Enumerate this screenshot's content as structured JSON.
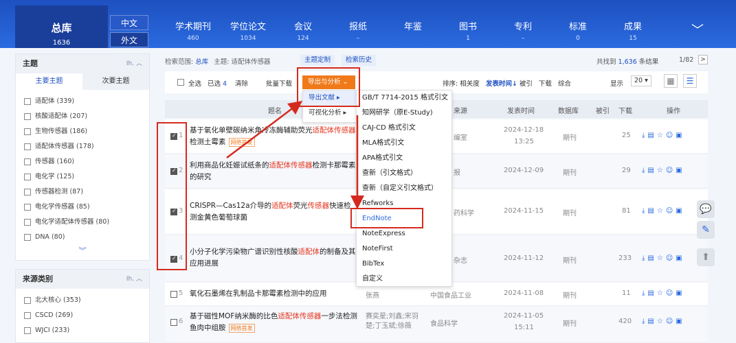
{
  "topnav": {
    "main": {
      "label": "总库",
      "count": "1636"
    },
    "lang": [
      "中文",
      "外文"
    ],
    "items": [
      {
        "label": "学术期刊",
        "count": "460"
      },
      {
        "label": "学位论文",
        "count": "1034"
      },
      {
        "label": "会议",
        "count": "124"
      },
      {
        "label": "报纸",
        "count": ""
      },
      {
        "label": "年鉴",
        "count": ""
      },
      {
        "label": "图书",
        "count": "1"
      },
      {
        "label": "专利",
        "count": ""
      },
      {
        "label": "标准",
        "count": "0"
      },
      {
        "label": "成果",
        "count": "15"
      }
    ]
  },
  "left": {
    "topic_title": "主题",
    "tabs": [
      "主要主题",
      "次要主题"
    ],
    "topics": [
      "适配体 (339)",
      "核酸适配体 (207)",
      "生物传感器 (186)",
      "适配体传感器 (178)",
      "传感器 (160)",
      "电化学 (125)",
      "传感器检测 (87)",
      "电化学传感器 (85)",
      "电化学适配体传感器 (80)",
      "DNA (80)"
    ],
    "source_title": "来源类别",
    "sources": [
      "北大核心 (353)",
      "CSCD (269)",
      "WJCI (233)"
    ]
  },
  "scope": {
    "label": "检索范围:",
    "db": "总库",
    "topic": "主题: 适配体传感器",
    "btn1": "主题定制",
    "btn2": "检索历史"
  },
  "found": {
    "prefix": "共找到",
    "count": "1,636",
    "suffix": "条结果",
    "page": "1/82"
  },
  "toolbar": {
    "select_all": "全选",
    "selected": "已选",
    "selected_n": "4",
    "clear": "清除",
    "batch": "批量下载",
    "export": "导出与分析",
    "sort_label": "排序:",
    "sorts": [
      "相关度",
      "发表时间",
      "被引",
      "下载",
      "综合"
    ],
    "display": "显示",
    "per_page": "20"
  },
  "dropdown1": [
    "导出文献",
    "可视化分析"
  ],
  "dropdown2": [
    "GB/T 7714-2015 格式引文",
    "知网研学（原E-Study)",
    "CAJ-CD 格式引文",
    "MLA格式引文",
    "APA格式引文",
    "查新（引文格式）",
    "查新（自定义引文格式）",
    "Refworks",
    "EndNote",
    "NoteExpress",
    "NoteFirst",
    "BibTex",
    "自定义"
  ],
  "table": {
    "headers": [
      "题名",
      "来源",
      "发表时间",
      "数据库",
      "被引",
      "下载",
      "操作"
    ],
    "rows": [
      {
        "n": "1",
        "t1": "基于氧化单壁碳纳米角冷冻酶辅助荧光",
        "h1": "适配体",
        "t2": "",
        "h2": "传感器",
        "t3": "检测土霉素",
        "tag": "网络首发",
        "src": "编室",
        "date": "2024-12-18",
        "time": "13:25",
        "db": "期刊",
        "cite": "",
        "dl": "25"
      },
      {
        "n": "2",
        "t1": "利用商品化妊娠试纸条的",
        "h1": "适配体传感器",
        "t2": "检测卡",
        "h2": "",
        "t3": "那霉素的研究",
        "tag": "",
        "src": "报",
        "date": "2024-12-09",
        "time": "",
        "db": "期刊",
        "cite": "",
        "dl": "29"
      },
      {
        "n": "3",
        "t1": "CRISPR—Cas12a介导的",
        "h1": "适配体",
        "t2": "荧光",
        "h2": "传感器",
        "t3": "快速检测金黄色葡萄球菌",
        "tag": "",
        "src": "药科学",
        "date": "2024-11-15",
        "time": "",
        "db": "期刊",
        "cite": "",
        "dl": "81"
      },
      {
        "n": "4",
        "t1": "小分子化学污染物广谱识别性核酸",
        "h1": "适配体",
        "t2": "的制",
        "h2": "",
        "t3": "备及其应用进展",
        "tag": "",
        "src": "杂志",
        "date": "2024-11-12",
        "time": "",
        "db": "期刊",
        "cite": "",
        "dl": "233"
      },
      {
        "n": "5",
        "t1": "氧化石墨烯在乳制品卡那霉素检测中的应用",
        "h1": "",
        "t2": "",
        "h2": "",
        "t3": "",
        "tag": "",
        "authors": "张燕",
        "src": "中国食品工业",
        "date": "2024-11-08",
        "time": "",
        "db": "期刊",
        "cite": "",
        "dl": "11"
      },
      {
        "n": "6",
        "t1": "基于磁性MOF纳米酶的比色",
        "h1": "适配体传感器",
        "t2": "一",
        "h2": "",
        "t3": "步法检测鱼肉中组胺",
        "tag": "网络首发",
        "authors": "赛奕星;刘鑫;宋羽楚;丁玉斌;徐薇",
        "src": "食品科学",
        "date": "2024-11-05",
        "time": "15:11",
        "db": "期刊",
        "cite": "",
        "dl": "420"
      }
    ]
  }
}
